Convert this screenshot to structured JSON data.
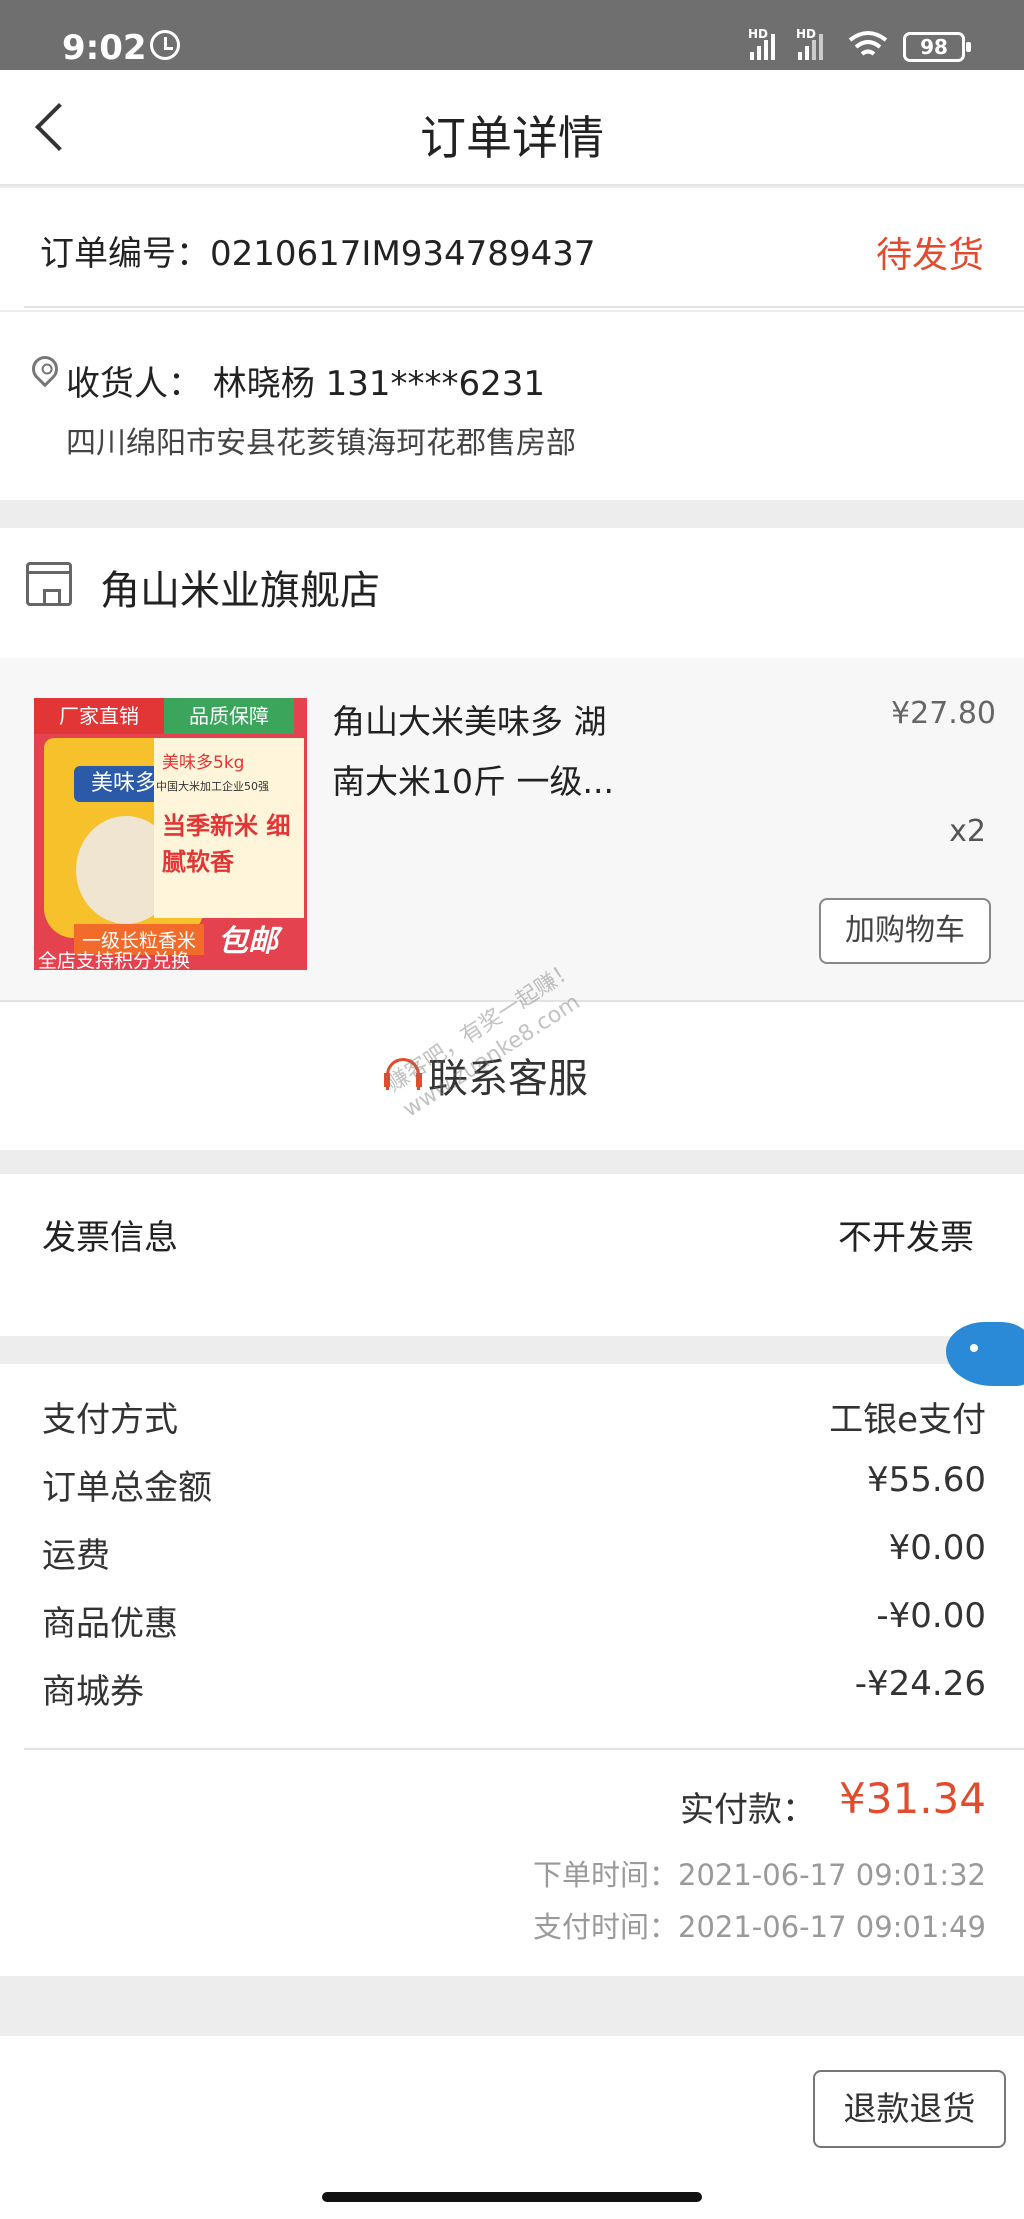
{
  "status_bar": {
    "time": "9:02",
    "battery": "98",
    "hd1": "HD",
    "hd2": "HD"
  },
  "header": {
    "title": "订单详情"
  },
  "order": {
    "number_label": "订单编号：0210617IM934789437",
    "status": "待发货"
  },
  "address": {
    "receiver_line": "收货人：  林晓杨 131****6231",
    "detail": "四川绵阳市安县花荄镇海珂花郡售房部"
  },
  "shop": {
    "name": "角山米业旗舰店"
  },
  "goods": {
    "name": "角山大米美味多 湖南大米10斤 一级...",
    "price": "¥27.80",
    "quantity": "x2",
    "cart_button": "加购物车",
    "thumb": {
      "tag_left": "厂家直销",
      "tag_right": "品质保障",
      "brand": "美味多",
      "panel_line1": "美味多5kg",
      "panel_line2": "中国大米加工企业50强",
      "panel_line3": "当季新米 细腻软香",
      "bottom_line1": "一级长粒香米",
      "bottom_line2": "全店支持积分兑换",
      "free_shipping": "包邮"
    }
  },
  "service": {
    "label": "联系客服",
    "watermark_line1": "赚客吧，有奖一起赚！",
    "watermark_line2": "www.zuanke8.com"
  },
  "invoice": {
    "label": "发票信息",
    "value": "不开发票"
  },
  "payment": {
    "rows": [
      {
        "label": "支付方式",
        "value": "工银e支付"
      },
      {
        "label": "订单总金额",
        "value": "¥55.60"
      },
      {
        "label": "运费",
        "value": "¥0.00"
      },
      {
        "label": "商品优惠",
        "value": "-¥0.00"
      },
      {
        "label": "商城券",
        "value": "-¥24.26"
      }
    ],
    "paid_label": "实付款：",
    "paid_value": "¥31.34",
    "order_time": "下单时间：2021-06-17 09:01:32",
    "pay_time": "支付时间：2021-06-17 09:01:49"
  },
  "footer": {
    "refund_button": "退款退货"
  },
  "colors": {
    "accent": "#e24b2d",
    "background": "#ededed"
  }
}
